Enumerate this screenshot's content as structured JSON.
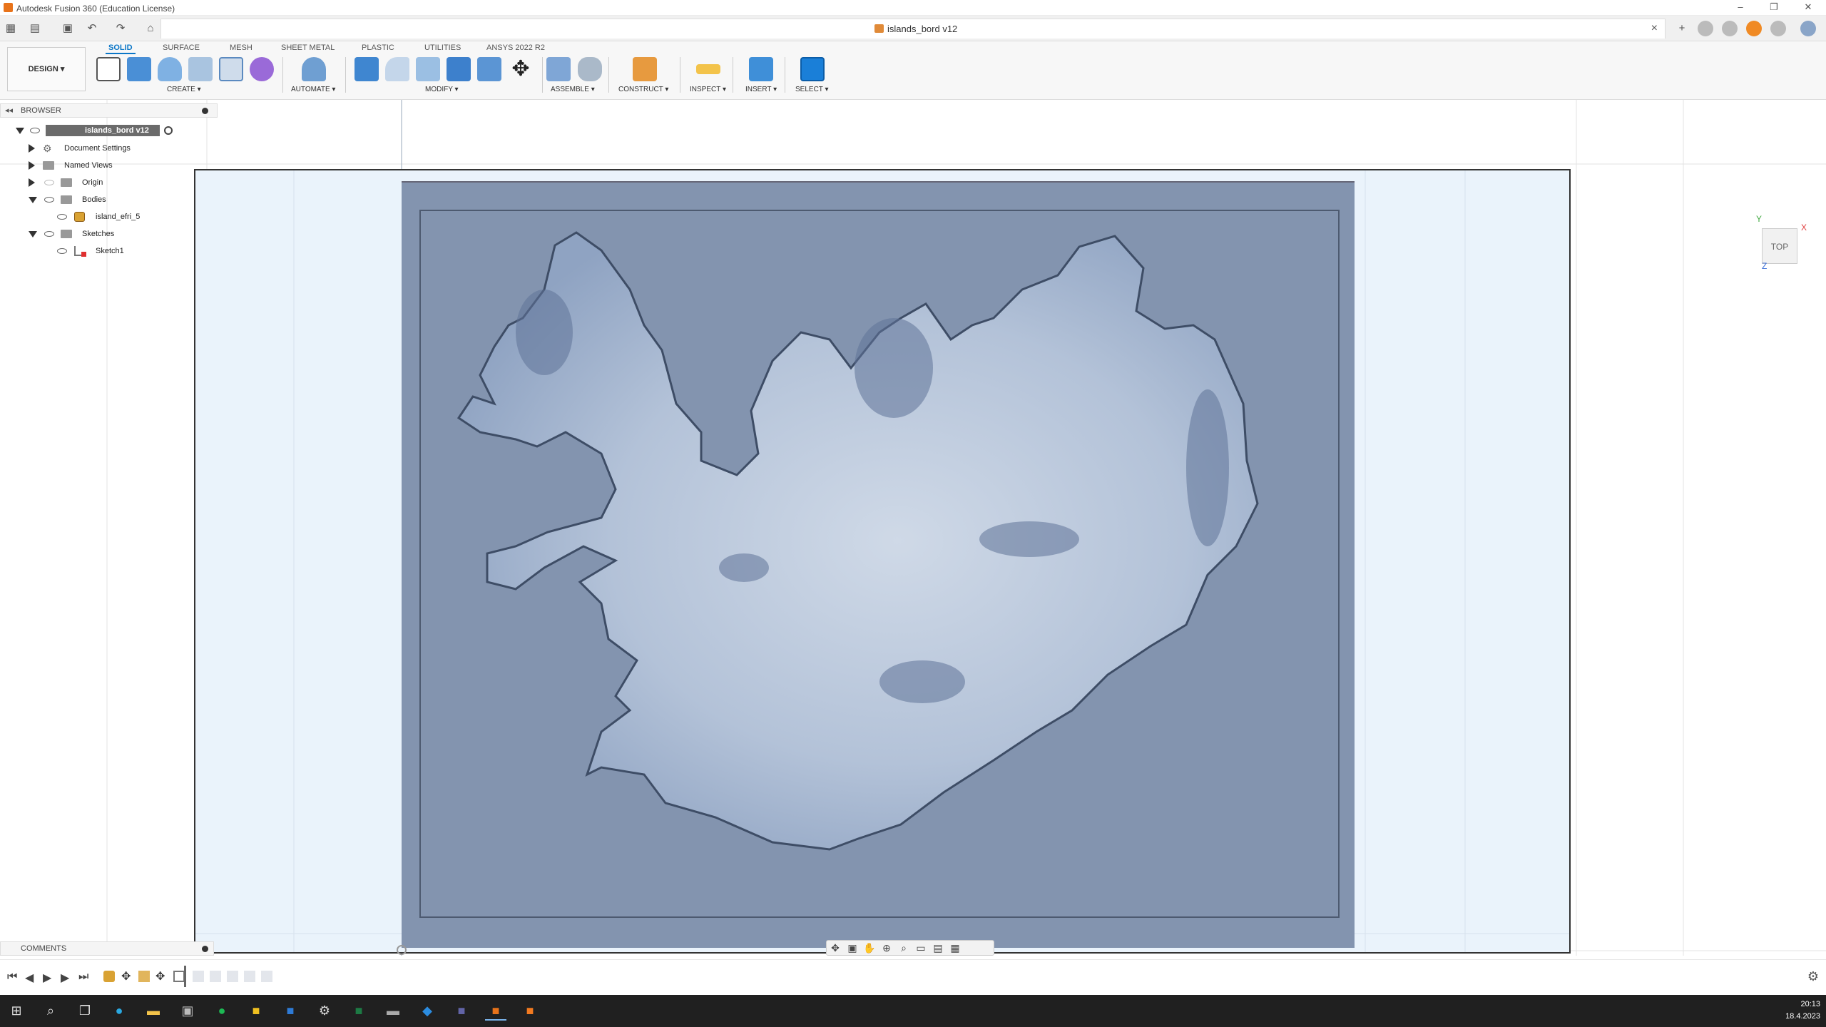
{
  "window": {
    "title": "Autodesk Fusion 360 (Education License)",
    "controls": [
      "–",
      "❐",
      "✕"
    ]
  },
  "doc_tab": {
    "title": "islands_bord v12"
  },
  "workspace_switcher": {
    "label": "DESIGN ▾"
  },
  "workspace_tabs": [
    "SOLID",
    "SURFACE",
    "MESH",
    "SHEET METAL",
    "PLASTIC",
    "UTILITIES",
    "ANSYS 2022 R2"
  ],
  "tool_groups": {
    "create": "CREATE ▾",
    "automate": "AUTOMATE ▾",
    "modify": "MODIFY ▾",
    "assemble": "ASSEMBLE ▾",
    "construct": "CONSTRUCT ▾",
    "inspect": "INSPECT ▾",
    "insert": "INSERT ▾",
    "select": "SELECT ▾"
  },
  "browser": {
    "title": "BROWSER",
    "root": "islands_bord v12",
    "items": [
      "Document Settings",
      "Named Views",
      "Origin",
      "Bodies",
      "island_efri_5",
      "Sketches",
      "Sketch1"
    ]
  },
  "viewcube": {
    "face": "TOP",
    "axis_x": "X",
    "axis_y": "Y",
    "axis_z": "Z"
  },
  "comments": {
    "title": "COMMENTS"
  },
  "clock": {
    "time": "20:13",
    "date": "18.4.2023"
  },
  "colors": {
    "accent": "#0a76c7",
    "plate": "#8394af",
    "grid_bg": "#eaf3fb",
    "taskbar": "#202020"
  }
}
